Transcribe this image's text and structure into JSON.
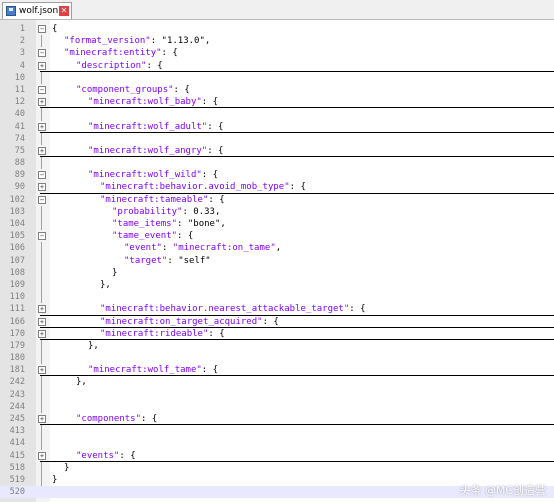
{
  "tab": {
    "title": "wolf.json",
    "close_icon": "close-icon",
    "file_icon": "save-icon"
  },
  "watermark": "头条 @MC创造营",
  "lines": [
    {
      "n": "1",
      "fold": "minus",
      "indent": 0,
      "parts": [
        {
          "t": "{",
          "c": "punc"
        }
      ],
      "ul": false
    },
    {
      "n": "2",
      "fold": "none",
      "indent": 1,
      "parts": [
        {
          "t": "\"format_version\"",
          "c": "key"
        },
        {
          "t": ": ",
          "c": "punc"
        },
        {
          "t": "\"1.13.0\"",
          "c": "str"
        },
        {
          "t": ",",
          "c": "punc"
        }
      ],
      "ul": false
    },
    {
      "n": "3",
      "fold": "minus",
      "indent": 1,
      "parts": [
        {
          "t": "\"minecraft:entity\"",
          "c": "key"
        },
        {
          "t": ": {",
          "c": "punc"
        }
      ],
      "ul": false
    },
    {
      "n": "4",
      "fold": "plus",
      "indent": 2,
      "parts": [
        {
          "t": "\"description\"",
          "c": "key"
        },
        {
          "t": ": {",
          "c": "punc"
        }
      ],
      "ul": true
    },
    {
      "n": "10",
      "fold": "none",
      "indent": 0,
      "parts": [],
      "ul": false
    },
    {
      "n": "11",
      "fold": "minus",
      "indent": 2,
      "parts": [
        {
          "t": "\"component_groups\"",
          "c": "key"
        },
        {
          "t": ": {",
          "c": "punc"
        }
      ],
      "ul": false
    },
    {
      "n": "12",
      "fold": "plus",
      "indent": 3,
      "parts": [
        {
          "t": "\"minecraft:wolf_baby\"",
          "c": "key"
        },
        {
          "t": ": {",
          "c": "punc"
        }
      ],
      "ul": true
    },
    {
      "n": "40",
      "fold": "none",
      "indent": 0,
      "parts": [],
      "ul": false
    },
    {
      "n": "41",
      "fold": "plus",
      "indent": 3,
      "parts": [
        {
          "t": "\"minecraft:wolf_adult\"",
          "c": "key"
        },
        {
          "t": ": {",
          "c": "punc"
        }
      ],
      "ul": true
    },
    {
      "n": "74",
      "fold": "none",
      "indent": 0,
      "parts": [],
      "ul": false
    },
    {
      "n": "75",
      "fold": "plus",
      "indent": 3,
      "parts": [
        {
          "t": "\"minecraft:wolf_angry\"",
          "c": "key"
        },
        {
          "t": ": {",
          "c": "punc"
        }
      ],
      "ul": true
    },
    {
      "n": "88",
      "fold": "none",
      "indent": 0,
      "parts": [],
      "ul": false
    },
    {
      "n": "89",
      "fold": "minus",
      "indent": 3,
      "parts": [
        {
          "t": "\"minecraft:wolf_wild\"",
          "c": "key"
        },
        {
          "t": ": {",
          "c": "punc"
        }
      ],
      "ul": false
    },
    {
      "n": "90",
      "fold": "plus",
      "indent": 4,
      "parts": [
        {
          "t": "\"minecraft:behavior.avoid_mob_type\"",
          "c": "key"
        },
        {
          "t": ": {",
          "c": "punc"
        }
      ],
      "ul": true
    },
    {
      "n": "102",
      "fold": "minus",
      "indent": 4,
      "parts": [
        {
          "t": "\"minecraft:tameable\"",
          "c": "key"
        },
        {
          "t": ": {",
          "c": "punc"
        }
      ],
      "ul": false
    },
    {
      "n": "103",
      "fold": "none",
      "indent": 5,
      "parts": [
        {
          "t": "\"probability\"",
          "c": "key"
        },
        {
          "t": ": 0.33,",
          "c": "punc"
        }
      ],
      "ul": false
    },
    {
      "n": "104",
      "fold": "none",
      "indent": 5,
      "parts": [
        {
          "t": "\"tame_items\"",
          "c": "key"
        },
        {
          "t": ": ",
          "c": "punc"
        },
        {
          "t": "\"bone\"",
          "c": "str"
        },
        {
          "t": ",",
          "c": "punc"
        }
      ],
      "ul": false
    },
    {
      "n": "105",
      "fold": "minus",
      "indent": 5,
      "parts": [
        {
          "t": "\"tame_event\"",
          "c": "key"
        },
        {
          "t": ": {",
          "c": "punc"
        }
      ],
      "ul": false
    },
    {
      "n": "106",
      "fold": "none",
      "indent": 6,
      "parts": [
        {
          "t": "\"event\"",
          "c": "key"
        },
        {
          "t": ": ",
          "c": "punc"
        },
        {
          "t": "\"minecraft:on_tame\"",
          "c": "key"
        },
        {
          "t": ",",
          "c": "punc"
        }
      ],
      "ul": false
    },
    {
      "n": "107",
      "fold": "none",
      "indent": 6,
      "parts": [
        {
          "t": "\"target\"",
          "c": "key"
        },
        {
          "t": ": ",
          "c": "punc"
        },
        {
          "t": "\"self\"",
          "c": "str"
        }
      ],
      "ul": false
    },
    {
      "n": "108",
      "fold": "none",
      "indent": 5,
      "parts": [
        {
          "t": "}",
          "c": "punc"
        }
      ],
      "ul": false
    },
    {
      "n": "109",
      "fold": "none",
      "indent": 4,
      "parts": [
        {
          "t": "},",
          "c": "punc"
        }
      ],
      "ul": false
    },
    {
      "n": "110",
      "fold": "none",
      "indent": 0,
      "parts": [],
      "ul": false
    },
    {
      "n": "111",
      "fold": "plus",
      "indent": 4,
      "parts": [
        {
          "t": "\"minecraft:behavior.nearest_attackable_target\"",
          "c": "key"
        },
        {
          "t": ": {",
          "c": "punc"
        }
      ],
      "ul": true
    },
    {
      "n": "166",
      "fold": "plus",
      "indent": 4,
      "parts": [
        {
          "t": "\"minecraft:on_target_acquired\"",
          "c": "key"
        },
        {
          "t": ": {",
          "c": "punc"
        }
      ],
      "ul": true
    },
    {
      "n": "170",
      "fold": "plus",
      "indent": 4,
      "parts": [
        {
          "t": "\"minecraft:rideable\"",
          "c": "key"
        },
        {
          "t": ": {",
          "c": "punc"
        }
      ],
      "ul": true
    },
    {
      "n": "179",
      "fold": "none",
      "indent": 3,
      "parts": [
        {
          "t": "},",
          "c": "punc"
        }
      ],
      "ul": false
    },
    {
      "n": "180",
      "fold": "none",
      "indent": 0,
      "parts": [],
      "ul": false
    },
    {
      "n": "181",
      "fold": "plus",
      "indent": 3,
      "parts": [
        {
          "t": "\"minecraft:wolf_tame\"",
          "c": "key"
        },
        {
          "t": ": {",
          "c": "punc"
        }
      ],
      "ul": true
    },
    {
      "n": "242",
      "fold": "none",
      "indent": 2,
      "parts": [
        {
          "t": "},",
          "c": "punc"
        }
      ],
      "ul": false
    },
    {
      "n": "243",
      "fold": "none",
      "indent": 0,
      "parts": [],
      "ul": false
    },
    {
      "n": "244",
      "fold": "none",
      "indent": 0,
      "parts": [],
      "ul": false
    },
    {
      "n": "245",
      "fold": "plus",
      "indent": 2,
      "parts": [
        {
          "t": "\"components\"",
          "c": "key"
        },
        {
          "t": ": {",
          "c": "punc"
        }
      ],
      "ul": true
    },
    {
      "n": "413",
      "fold": "none",
      "indent": 0,
      "parts": [],
      "ul": false
    },
    {
      "n": "414",
      "fold": "none",
      "indent": 0,
      "parts": [],
      "ul": false
    },
    {
      "n": "415",
      "fold": "plus",
      "indent": 2,
      "parts": [
        {
          "t": "\"events\"",
          "c": "key"
        },
        {
          "t": ": {",
          "c": "punc"
        }
      ],
      "ul": true
    },
    {
      "n": "518",
      "fold": "none",
      "indent": 1,
      "parts": [
        {
          "t": "}",
          "c": "punc"
        }
      ],
      "ul": false
    },
    {
      "n": "519",
      "fold": "none",
      "indent": 0,
      "parts": [
        {
          "t": "}",
          "c": "punc"
        }
      ],
      "ul": false
    },
    {
      "n": "520",
      "fold": "none",
      "indent": 0,
      "parts": [],
      "ul": false,
      "current": true
    }
  ]
}
